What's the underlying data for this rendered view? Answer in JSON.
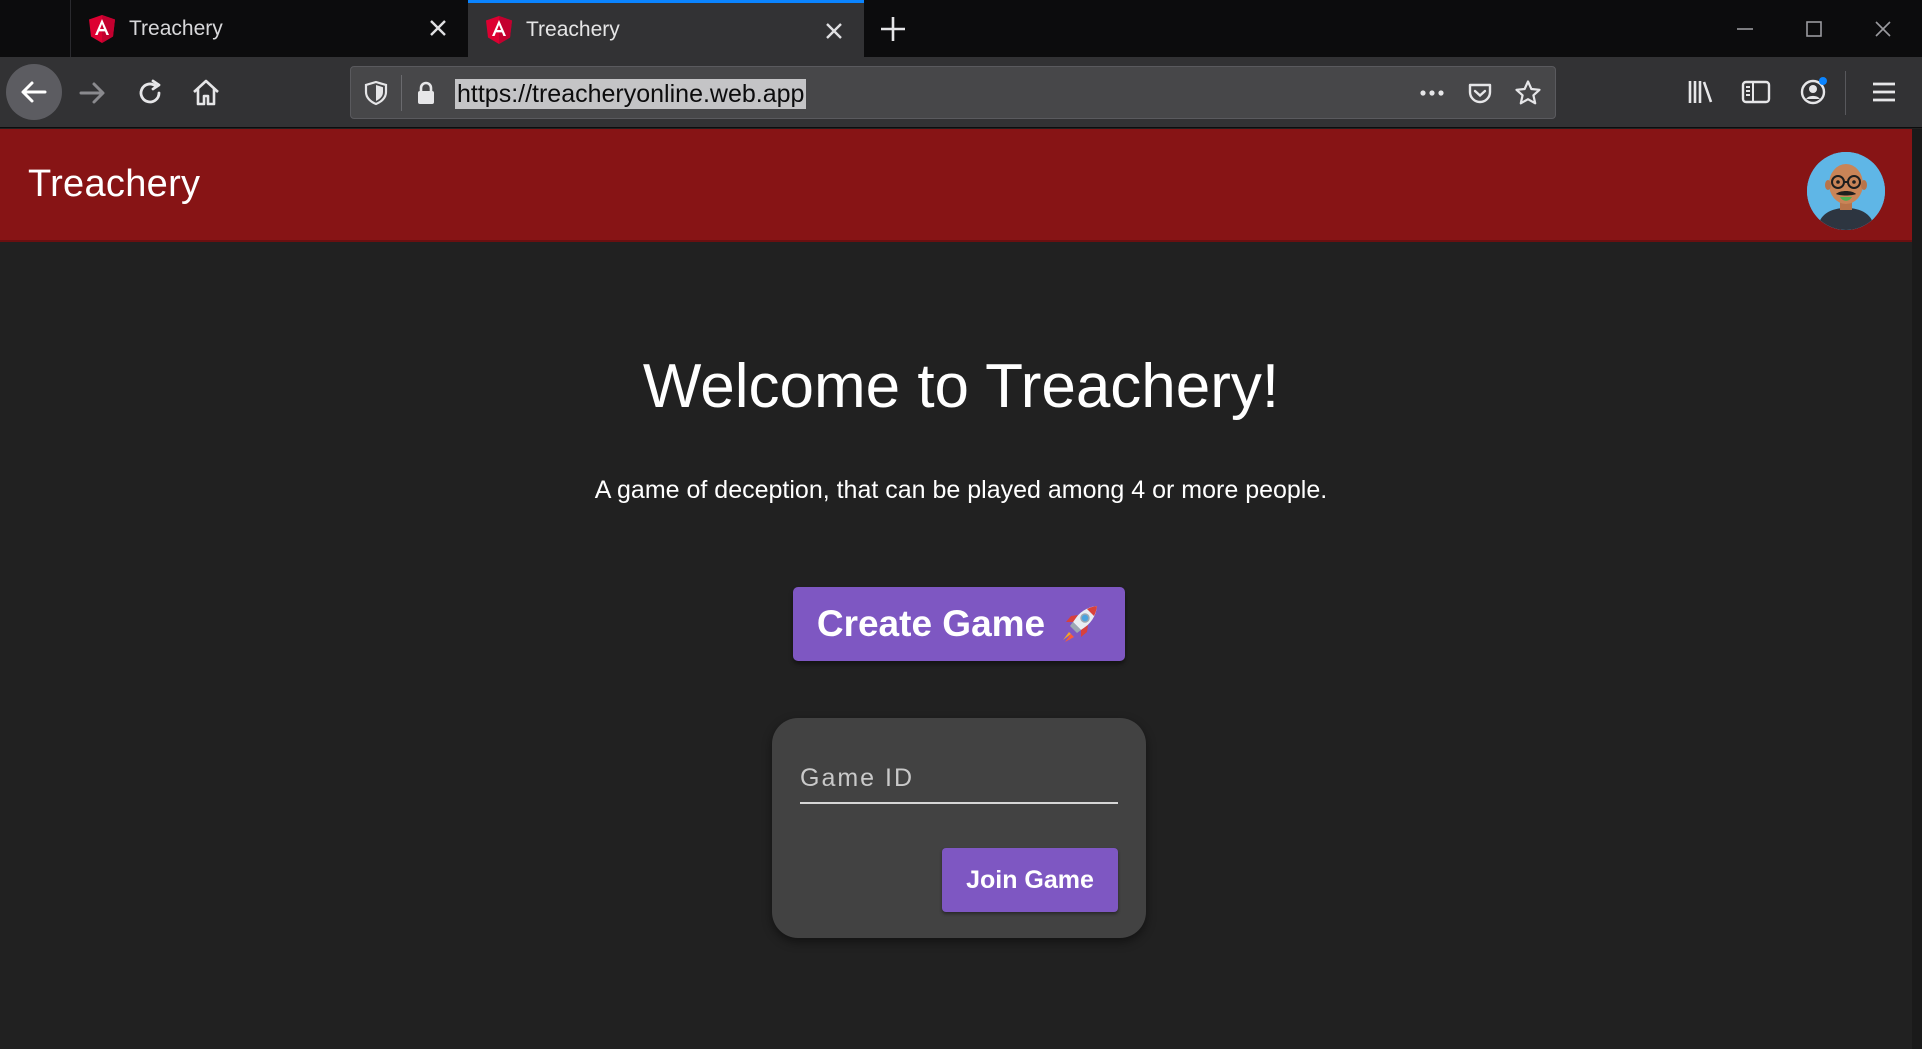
{
  "browser": {
    "tabs": [
      {
        "title": "Treachery",
        "icon": "angular-icon",
        "active": false
      },
      {
        "title": "Treachery",
        "icon": "angular-icon",
        "active": true
      }
    ],
    "url": "https://treacheryonline.web.app",
    "accent_color": "#0a84ff"
  },
  "header": {
    "title": "Treachery",
    "background_color": "#871415"
  },
  "main": {
    "welcome": "Welcome to Treachery!",
    "tagline": "A game of deception, that can be played among 4 or more people.",
    "create_button": "Create Game",
    "create_icon": "rocket-icon",
    "game_id_placeholder": "Game ID",
    "join_button": "Join Game",
    "button_color": "#7e57c2"
  }
}
